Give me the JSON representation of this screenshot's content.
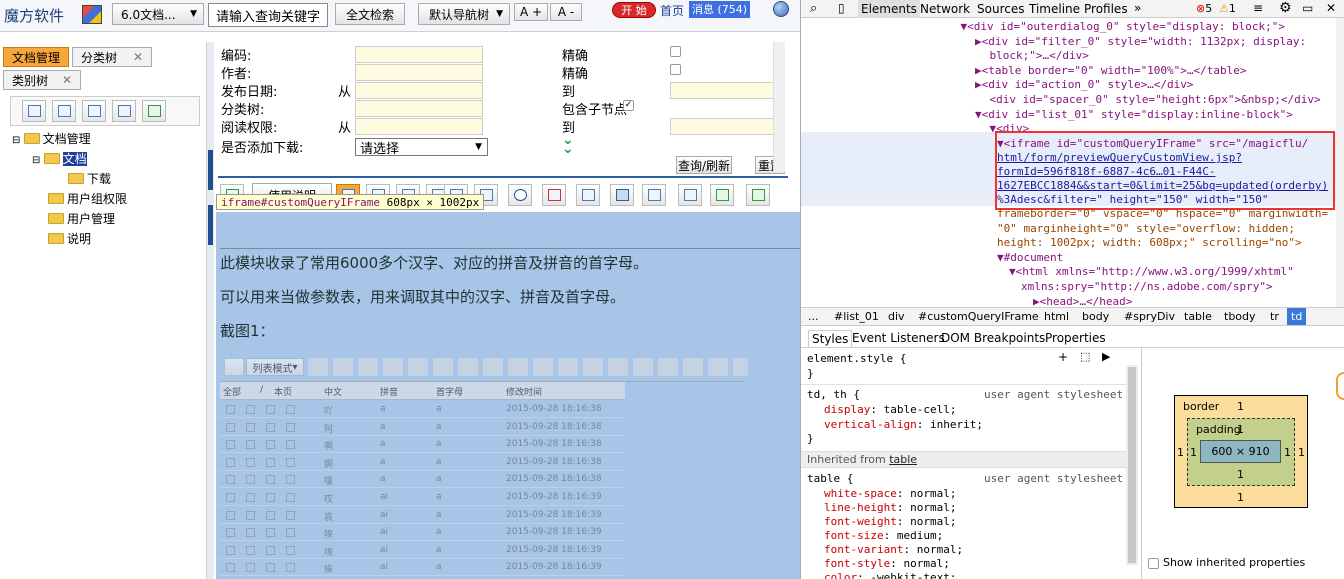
{
  "app": {
    "logo_text": "魔方软件",
    "version_select": "6.0文档...",
    "search_placeholder": "请输入查询关键字",
    "fulltext_search": "全文检索",
    "nav_tree_select": "默认导航树",
    "font_inc": "A +",
    "font_dec": "A -",
    "start_button": "开 始",
    "home_link": "首页",
    "messages": "消息 (754)"
  },
  "left_tabs": [
    "文档管理",
    "分类树",
    "类别树"
  ],
  "tree": {
    "root": "文档管理",
    "doc": "文档",
    "download": "下载",
    "usergroup": "用户组权限",
    "usermgmt": "用户管理",
    "desc": "说明"
  },
  "form": {
    "code": "编码:",
    "author": "作者:",
    "pubdate": "发布日期:",
    "from1": "从",
    "category": "分类树:",
    "readperm": "阅读权限:",
    "from2": "从",
    "allowdl": "是否添加下载:",
    "exact1": "精确",
    "exact2": "精确",
    "to1": "到",
    "subnode": "包含子节点",
    "to2": "到",
    "select_value": "请选择",
    "query_button": "查询/刷新",
    "reset_button": "重置"
  },
  "tooltip": {
    "selector": "iframe#customQueryIFrame",
    "size": "608px × 1002px"
  },
  "toolbar": {
    "usage_button": "使用说明"
  },
  "content": {
    "para1": "此模块收录了常用6000多个汉字、对应的拼音及拼音的首字母。",
    "para2": "可以用来当做参数表，用来调取其中的汉字、拼音及首字母。",
    "para3": "截图1："
  },
  "inner": {
    "list_mode": "列表模式",
    "headers": [
      "全部",
      "/",
      "本页",
      "中文",
      "拼音",
      "首字母",
      "修改时间"
    ],
    "rows": [
      [
        "吖",
        "a",
        "a",
        "2015-09-28 18:16:38"
      ],
      [
        "阿",
        "a",
        "a",
        "2015-09-28 18:16:38"
      ],
      [
        "啊",
        "a",
        "a",
        "2015-09-28 18:16:38"
      ],
      [
        "锕",
        "a",
        "a",
        "2015-09-28 18:16:38"
      ],
      [
        "嗄",
        "a",
        "a",
        "2015-09-28 18:16:38"
      ],
      [
        "哎",
        "ai",
        "a",
        "2015-09-28 18:16:39"
      ],
      [
        "哀",
        "ai",
        "a",
        "2015-09-28 18:16:39"
      ],
      [
        "唉",
        "ai",
        "a",
        "2015-09-28 18:16:39"
      ],
      [
        "埃",
        "ai",
        "a",
        "2015-09-28 18:16:39"
      ],
      [
        "挨",
        "ai",
        "a",
        "2015-09-28 18:16:39"
      ]
    ]
  },
  "devtools": {
    "tabs": [
      "Elements",
      "Network",
      "Sources",
      "Timeline",
      "Profiles",
      "»"
    ],
    "errors": "5",
    "warnings": "1",
    "dom": [
      {
        "i": 11,
        "t": "▼<div id=\"outerdialog_0\" style=\"display: block;\">"
      },
      {
        "i": 12,
        "t": "▶<div id=\"filter_0\" style=\"width: 1132px; display:"
      },
      {
        "i": 13,
        "t": "block;\">…</div>"
      },
      {
        "i": 12,
        "t": "▶<table border=\"0\" width=\"100%\">…</table>"
      },
      {
        "i": 12,
        "t": "▶<div id=\"action_0\" style>…</div>"
      },
      {
        "i": 13,
        "t": "<div id=\"spacer_0\" style=\"height:6px\">&nbsp;</div>"
      },
      {
        "i": 12,
        "t": "▼<div id=\"list_01\" style=\"display:inline-block\">"
      },
      {
        "i": 13,
        "t": "▼<div>"
      }
    ],
    "iframe_lines": [
      "▼<iframe id=\"customQueryIFrame\" src=\"/magicflu/",
      "html/form/previewQueryCustomView.jsp?",
      "formId=596f818f-6887-4c6…01-F44C-",
      "1627EBCC1884&&start=0&limit=25&bq=updated(orderby)",
      "%3Adesc&filter=\" height=\"150\" width=\"150\""
    ],
    "dom_after": [
      {
        "i": 1,
        "t": "frameborder=\"0\" vspace=\"0\" hspace=\"0\" marginwidth="
      },
      {
        "i": 1,
        "t": "\"0\" marginheight=\"0\" style=\"overflow: hidden;"
      },
      {
        "i": 1,
        "t": "height: 1002px; width: 608px;\" scrolling=\"no\">"
      },
      {
        "i": 2,
        "t": "▼#document"
      },
      {
        "i": 3,
        "t": "▼<html xmlns=\"http://www.w3.org/1999/xhtml\""
      },
      {
        "i": 4,
        "t": "xmlns:spry=\"http://ns.adobe.com/spry\">"
      },
      {
        "i": 5,
        "t": "▶<head>…</head>"
      }
    ],
    "breadcrumb": [
      "...",
      "#list_01",
      "div",
      "#customQueryIFrame",
      "html",
      "body",
      "#spryDiv",
      "table",
      "tbody",
      "tr",
      "td"
    ],
    "subtabs": [
      "Styles",
      "Event Listeners",
      "DOM Breakpoints",
      "Properties"
    ],
    "styles": {
      "element_style": "element.style {",
      "close1": "}",
      "rule1_sel": "td, th {",
      "ua1": "user agent stylesheet",
      "r1p1": "display",
      "r1v1": "table-cell;",
      "r1p2": "vertical-align",
      "r1v2": "inherit;",
      "close2": "}",
      "inherited_label": "Inherited from",
      "inherited_from": "table",
      "rule2_sel": "table {",
      "ua2": "user agent stylesheet",
      "r2p1": "white-space",
      "r2v1": "normal;",
      "r2p2": "line-height",
      "r2v2": "normal;",
      "r2p3": "font-weight",
      "r2v3": "normal;",
      "r2p4": "font-size",
      "r2v4": "medium;",
      "r2p5": "font-variant",
      "r2v5": "normal;",
      "r2p6": "font-style",
      "r2v6": "normal;",
      "r2p7": "color",
      "r2v7": "-webkit-text;"
    },
    "boxmodel": {
      "border": "border",
      "border_val": "1",
      "padding": "padding",
      "padding_val": "1",
      "content": "600 × 910",
      "side": "1",
      "bottom_pad": "1",
      "bottom_border": "1"
    },
    "show_inherited": "Show inherited properties"
  }
}
